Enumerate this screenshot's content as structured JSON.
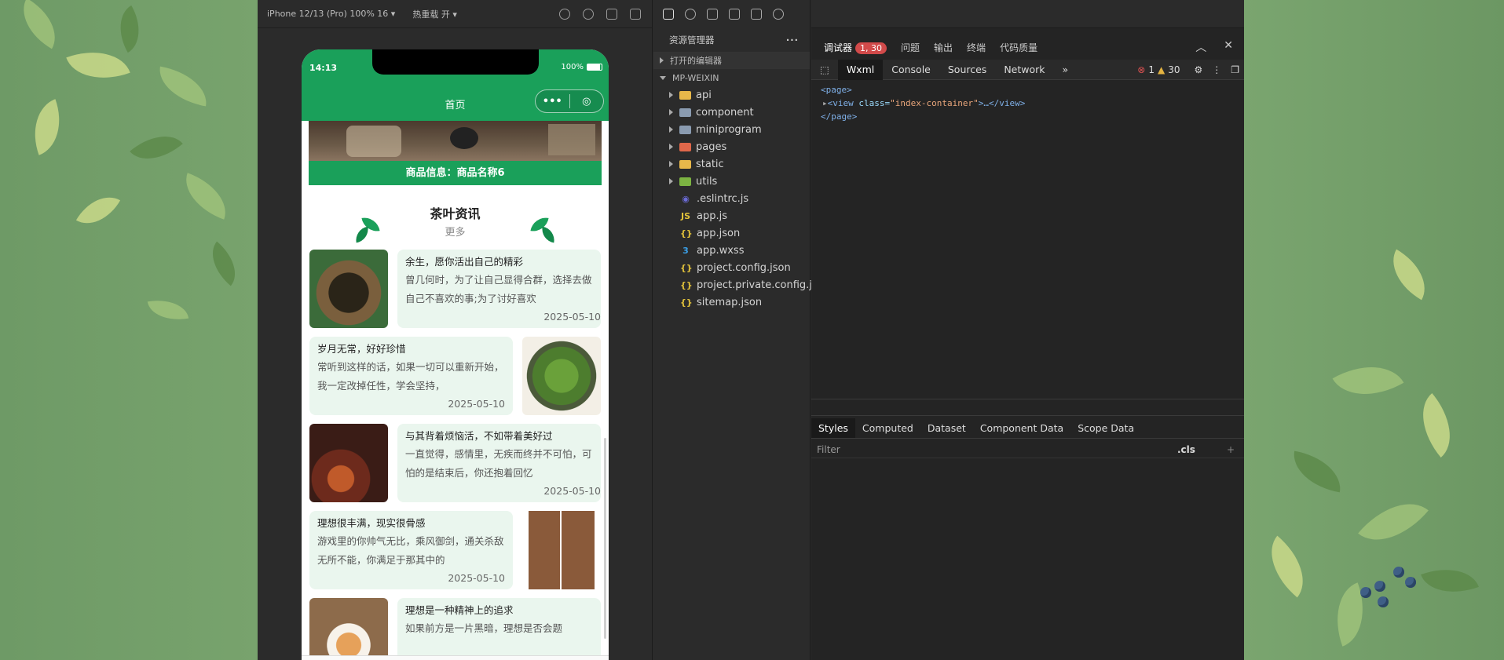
{
  "simulator": {
    "device": "iPhone 12/13 (Pro) 100% 16 ▾",
    "hot_reload": "热重载 开 ▾"
  },
  "phone": {
    "time": "14:13",
    "battery": "100%",
    "page_title": "首页",
    "capsule_menu": "•••",
    "capsule_close": "◎",
    "goods_info": "商品信息：商品名称6",
    "section_title": "茶叶资讯",
    "section_more": "更多",
    "news": [
      {
        "title": "余生，愿你活出自己的精彩",
        "summary": "曾几何时，为了让自己显得合群，选择去做自己不喜欢的事;为了讨好喜欢",
        "date": "2025-05-10",
        "image": "dark-tea-leaves-image"
      },
      {
        "title": "岁月无常，好好珍惜",
        "summary": "常听到这样的话，如果一切可以重新开始，我一定改掉任性，学会坚持，",
        "date": "2025-05-10",
        "image": "green-tea-bowl-image"
      },
      {
        "title": "与其背着烦恼活，不如带着美好过",
        "summary": "一直觉得，感情里，无疾而终并不可怕，可怕的是结束后，你还抱着回忆",
        "date": "2025-05-10",
        "image": "black-tea-cup-image"
      },
      {
        "title": "理想很丰满，现实很骨感",
        "summary": "游戏里的你帅气无比，乘风御剑，通关杀敌无所不能，你满足于那其中的",
        "date": "2025-05-10",
        "image": "tea-jars-image"
      },
      {
        "title": "理想是一种精神上的追求",
        "summary": "如果前方是一片黑暗，理想是否会题",
        "date": "",
        "image": "tea-set-image"
      }
    ]
  },
  "explorer": {
    "title": "资源管理器",
    "more": "···",
    "open_editors": "打开的编辑器",
    "project": "MP-WEIXIN",
    "folders": [
      {
        "name": "api",
        "color": "#e8b84a",
        "icon": "folder-api-icon"
      },
      {
        "name": "component",
        "color": "#8a9bb0",
        "icon": "folder-icon"
      },
      {
        "name": "miniprogram",
        "color": "#8a9bb0",
        "icon": "folder-icon"
      },
      {
        "name": "pages",
        "color": "#e0674a",
        "icon": "folder-pages-icon"
      },
      {
        "name": "static",
        "color": "#e8b84a",
        "icon": "folder-static-icon"
      },
      {
        "name": "utils",
        "color": "#7cb342",
        "icon": "folder-utils-icon"
      }
    ],
    "files": [
      {
        "name": ".eslintrc.js",
        "glyph": "◉",
        "color": "#6b6bd6",
        "icon": "eslint-file-icon"
      },
      {
        "name": "app.js",
        "glyph": "JS",
        "color": "#e3c33a",
        "icon": "js-file-icon"
      },
      {
        "name": "app.json",
        "glyph": "{}",
        "color": "#e3c33a",
        "icon": "json-file-icon"
      },
      {
        "name": "app.wxss",
        "glyph": "3",
        "color": "#3aa0e8",
        "icon": "css-file-icon"
      },
      {
        "name": "project.config.json",
        "glyph": "{}",
        "color": "#e3c33a",
        "icon": "json-file-icon"
      },
      {
        "name": "project.private.config.js...",
        "glyph": "{}",
        "color": "#e3c33a",
        "icon": "json-file-icon"
      },
      {
        "name": "sitemap.json",
        "glyph": "{}",
        "color": "#e3c33a",
        "icon": "json-file-icon"
      }
    ]
  },
  "devtools": {
    "tabs": [
      "调试器",
      "问题",
      "输出",
      "终端",
      "代码质量"
    ],
    "debugger_badge": "1, 30",
    "panel_tabs": [
      "Wxml",
      "Console",
      "Sources",
      "Network",
      "»"
    ],
    "error_count": "1",
    "warning_count": "30",
    "code": {
      "page_open": "<page>",
      "view_tag_open": "<view ",
      "view_attr": "class=",
      "view_val": "\"index-container\"",
      "view_rest": ">…</view>",
      "page_close": "</page>"
    },
    "style_tabs": [
      "Styles",
      "Computed",
      "Dataset",
      "Component Data",
      "Scope Data"
    ],
    "filter_placeholder": "Filter",
    "cls": ".cls",
    "plus": "+"
  }
}
